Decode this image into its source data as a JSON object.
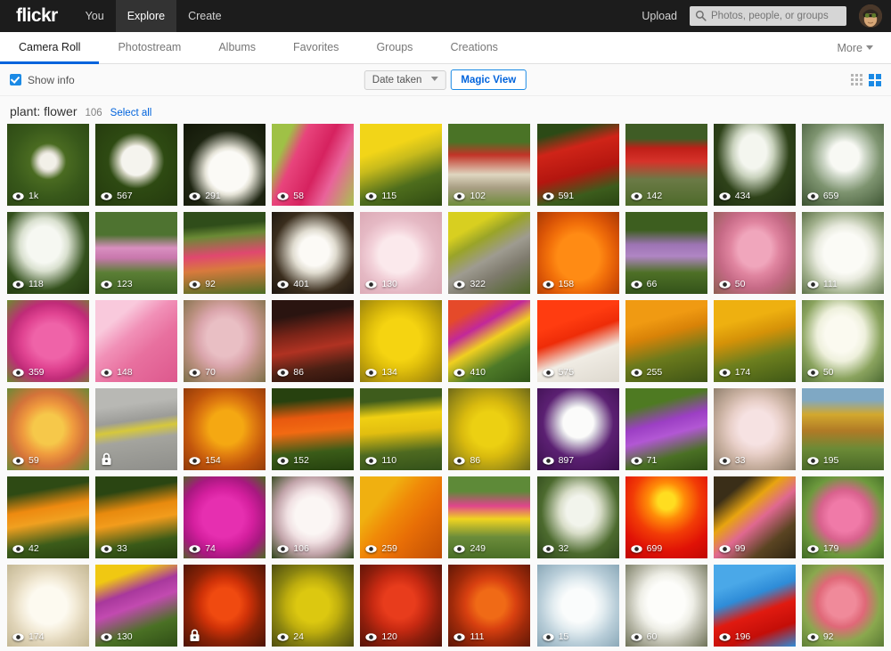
{
  "header": {
    "logo": "flickr",
    "nav": [
      {
        "label": "You",
        "active": false
      },
      {
        "label": "Explore",
        "active": true
      },
      {
        "label": "Create",
        "active": false
      }
    ],
    "upload_label": "Upload",
    "search": {
      "placeholder": "Photos, people, or groups",
      "value": "",
      "icon": "search-icon"
    },
    "avatar_alt": "user-avatar"
  },
  "tabs": [
    {
      "label": "Camera Roll",
      "active": true
    },
    {
      "label": "Photostream",
      "active": false
    },
    {
      "label": "Albums",
      "active": false
    },
    {
      "label": "Favorites",
      "active": false
    },
    {
      "label": "Groups",
      "active": false
    },
    {
      "label": "Creations",
      "active": false
    }
  ],
  "more_tab": {
    "label": "More",
    "icon": "chevron-down-icon"
  },
  "toolbar": {
    "show_info_label": "Show info",
    "show_info_checked": true,
    "sort_label": "Date taken",
    "sort_icon": "chevron-down-icon",
    "magic_view_label": "Magic View",
    "view_small_icon": "grid-small-icon",
    "view_large_icon": "grid-large-icon",
    "view_active": "large"
  },
  "group": {
    "title": "plant: flower",
    "count": "106",
    "select_all_label": "Select all"
  },
  "colors": {
    "accent": "#0063dc",
    "accent_light": "#1b8ae5",
    "topbar_bg": "#1c1c1c",
    "page_bg": "#fafafa"
  },
  "photos": [
    {
      "views": "1k",
      "locked": false,
      "name": "dandelion-seedhead-green",
      "bg": "radial-gradient(circle at 50% 46%, #f2f0e8 0 13%, #d8d6c8 17%, #4a6b21 30%, #38581a 60%, #2c4714 100%)"
    },
    {
      "views": "567",
      "locked": false,
      "name": "dandelion-seedhead-dark",
      "bg": "radial-gradient(circle at 50% 45%, #f5f4ee 0 24%, #cfd0bd 28%, #2e4a12 46%, #24390e 100%)"
    },
    {
      "views": "291",
      "locked": false,
      "name": "white-camellia",
      "bg": "radial-gradient(circle at 55% 58%, #fbfaf6 0 30%, #e4e2d6 36%, #1d2411 62%, #121708 100%)"
    },
    {
      "views": "58",
      "locked": false,
      "name": "pink-ginger-flower",
      "bg": "linear-gradient(115deg, #9fc146 0 18%, #e8447c 32%, #d6225f 55%, #e9639a 72%, #a8c24f 100%)"
    },
    {
      "views": "115",
      "locked": false,
      "name": "yellow-tulips-field",
      "bg": "linear-gradient(160deg, #f2d518 0 30%, #c8bb1c 45%, #4e6d1c 70%, #2f4a12 100%)"
    },
    {
      "views": "102",
      "locked": false,
      "name": "red-tulip-garden-path",
      "bg": "linear-gradient(180deg, #4a7326 0 22%, #c23427 38%, #dfd6c0 62%, #a89e83 78%, #6e8c3a 100%)"
    },
    {
      "views": "591",
      "locked": false,
      "name": "red-tulips-closeup",
      "bg": "linear-gradient(165deg, #2c4a16 0 14%, #cf2418 32%, #b4160f 58%, #3c5c1c 80%, #2a4512 100%)"
    },
    {
      "views": "142",
      "locked": false,
      "name": "red-tulip-rows",
      "bg": "linear-gradient(180deg, #3f5c25 0 18%, #c01f18 30%, #d6332a 46%, #6b7a46 68%, #4e6a2a 100%)"
    },
    {
      "views": "434",
      "locked": false,
      "name": "white-queen-annes-lace",
      "bg": "radial-gradient(ellipse at 48% 34%, #f4f6ef 0 22%, #c9d2bd 34%, #2e4219 60%, #1d2c10 100%)"
    },
    {
      "views": "659",
      "locked": false,
      "name": "dandelion-backlit",
      "bg": "radial-gradient(circle at 52% 40%, #f8f9f4 0 22%, #cfd8c9 32%, #7e9470 55%, #3b5230 100%)"
    },
    {
      "views": "118",
      "locked": false,
      "name": "white-hydrangea-bush",
      "bg": "radial-gradient(ellipse at 45% 40%, #f6f8f2 0 26%, #d9e0cf 38%, #33501c 66%, #22380f 100%)"
    },
    {
      "views": "123",
      "locked": false,
      "name": "pink-tulip-meadow",
      "bg": "linear-gradient(180deg, #4e7330 0 28%, #d98fc0 44%, #c878ad 56%, #5b7f35 74%, #3e6122 100%)"
    },
    {
      "views": "92",
      "locked": false,
      "name": "person-in-flower-field",
      "bg": "linear-gradient(175deg, #2f4d1a 0 18%, #6a8a35 30%, #e0486f 52%, #d97a3d 68%, #4c6d24 100%)"
    },
    {
      "views": "401",
      "locked": false,
      "name": "white-cherry-blossom",
      "bg": "radial-gradient(ellipse at 52% 48%, #fcfaf6 0 24%, #e0dcd0 36%, #3a2d1d 68%, #1d1610 100%)"
    },
    {
      "views": "130",
      "locked": false,
      "name": "pink-cherry-blossom",
      "bg": "radial-gradient(ellipse at 46% 52%, #fbe9ec 0 30%, #f2d0d8 44%, #e5b9c4 62%, #d9a6b2 100%)"
    },
    {
      "views": "322",
      "locked": false,
      "name": "stone-steps-yellow-flowers",
      "bg": "linear-gradient(150deg, #d8cf20 0 22%, #9aa428 36%, #9e9b90 54%, #7f7b6e 70%, #4c6524 100%)"
    },
    {
      "views": "158",
      "locked": false,
      "name": "orange-tulip-macro",
      "bg": "radial-gradient(ellipse at 50% 55%, #ff8b14 0 36%, #f2700a 52%, #d85306 72%, #a83a04 100%)"
    },
    {
      "views": "66",
      "locked": false,
      "name": "purple-tulip-field",
      "bg": "linear-gradient(180deg, #3d5e1f 0 22%, #9d74b4 40%, #b085c4 54%, #4e7026 74%, #33521a 100%)"
    },
    {
      "views": "50",
      "locked": false,
      "name": "pink-blossom-tree",
      "bg": "radial-gradient(ellipse at 50% 45%, #f0a6bc 0 28%, #e085a0 42%, #c66a86 62%, #8e5f52 100%)"
    },
    {
      "views": "111",
      "locked": false,
      "name": "white-lotus-flower",
      "bg": "radial-gradient(ellipse at 52% 50%, #fbfbf6 0 34%, #e8eade 48%, #9fae8a 72%, #5d7248 100%)"
    },
    {
      "views": "359",
      "locked": false,
      "name": "pink-azalea-macro",
      "bg": "radial-gradient(ellipse at 55% 50%, #ef63a8 0 30%, #e04391 48%, #c02b78 66%, #6b8b2e 100%)"
    },
    {
      "views": "148",
      "locked": false,
      "name": "pink-tulip-petal",
      "bg": "linear-gradient(140deg, #f9c9dc 0 24%, #f190b7 42%, #e8709f 62%, #dd588d 100%)"
    },
    {
      "views": "70",
      "locked": false,
      "name": "pink-blossom-branch",
      "bg": "radial-gradient(ellipse at 50% 46%, #e9bfc4 0 30%, #dba6ad 46%, #b98f7e 66%, #7c6f48 100%)"
    },
    {
      "views": "86",
      "locked": false,
      "name": "red-flower-stems-dark",
      "bg": "linear-gradient(170deg, #2a1410 0 20%, #7a2418 40%, #b03222 58%, #4a2014 80%, #2a120c 100%)"
    },
    {
      "views": "134",
      "locked": false,
      "name": "yellow-forsythia",
      "bg": "radial-gradient(ellipse at 48% 48%, #f5d411 0 34%, #e2c10c 50%, #c2a30a 70%, #8c7a12 100%)"
    },
    {
      "views": "410",
      "locked": false,
      "name": "mixed-tulip-bouquet",
      "bg": "linear-gradient(150deg, #e54a2a 0 18%, #c2289a 34%, #f0d020 50%, #4e7a28 72%, #2f5418 100%)"
    },
    {
      "views": "575",
      "locked": false,
      "name": "red-poppies-white",
      "bg": "linear-gradient(160deg, #ff3c10 0 28%, #ee2c08 44%, #f0ece4 66%, #ddd8ce 100%)"
    },
    {
      "views": "255",
      "locked": false,
      "name": "orange-tulips-sunlit",
      "bg": "linear-gradient(165deg, #f09a12 0 26%, #d98308 42%, #6b7a1c 66%, #3e5416 100%)"
    },
    {
      "views": "174",
      "locked": false,
      "name": "yellow-tulips-sunlit",
      "bg": "linear-gradient(165deg, #eeb010 0 26%, #d59208 44%, #6d7f1e 68%, #3f5816 100%)"
    },
    {
      "views": "50",
      "locked": false,
      "name": "white-frangipani",
      "bg": "radial-gradient(ellipse at 48% 42%, #fbfaf0 0 26%, #eef0dc 40%, #8aa35e 66%, #4d6b33 100%)"
    },
    {
      "views": "59",
      "locked": false,
      "name": "orange-yellow-blossoms",
      "bg": "radial-gradient(ellipse at 50% 50%, #f6c84a 0 26%, #ef9a3e 44%, #d4733a 64%, #6b8a36 100%)"
    },
    {
      "views": "",
      "locked": true,
      "name": "road-with-yellow-lines",
      "bg": "linear-gradient(172deg, #b8b8b4 0 22%, #9c9c98 40%, #d6c83c 50%, #a4a49e 62%, #8e8e8a 100%)"
    },
    {
      "views": "154",
      "locked": false,
      "name": "autumn-maple-leaf",
      "bg": "radial-gradient(ellipse at 52% 48%, #f5a812 0 28%, #e07d10 46%, #c2560c 66%, #8e3808 100%)"
    },
    {
      "views": "152",
      "locked": false,
      "name": "orange-tulips-green",
      "bg": "linear-gradient(175deg, #27410f 0 16%, #e8590f 36%, #f26a12 52%, #3b5c18 76%, #24400e 100%)"
    },
    {
      "views": "110",
      "locked": false,
      "name": "yellow-tulips-rows",
      "bg": "linear-gradient(175deg, #3e5c1c 0 16%, #f0d012 34%, #e2be10 52%, #4e6a20 76%, #33511a 100%)"
    },
    {
      "views": "86",
      "locked": false,
      "name": "yellow-forsythia-branch",
      "bg": "radial-gradient(ellipse at 50% 50%, #ecd012 0 30%, #d9ba0e 48%, #b09c14 68%, #6f6a18 100%)"
    },
    {
      "views": "897",
      "locked": false,
      "name": "dandelion-purple-bg",
      "bg": "radial-gradient(circle at 50% 42%, #fbfbfa 0 24%, #d8d4df 30%, #5b2072 56%, #3a0e4c 100%)"
    },
    {
      "views": "71",
      "locked": false,
      "name": "purple-wildflowers",
      "bg": "linear-gradient(165deg, #4e7a22 0 22%, #9c3fc4 42%, #b257d4 56%, #4a7024 78%, #2f4e16 100%)"
    },
    {
      "views": "33",
      "locked": false,
      "name": "pink-blossom-hand",
      "bg": "radial-gradient(ellipse at 52% 48%, #f6e2e2 0 28%, #e8cfc8 44%, #c8b0a0 64%, #8a7a68 100%)"
    },
    {
      "views": "195",
      "locked": false,
      "name": "autumn-forest-hills",
      "bg": "linear-gradient(180deg, #7fa8c4 0 14%, #d2a82e 32%, #b07a26 52%, #6b8a36 74%, #4a6a28 100%)"
    },
    {
      "views": "42",
      "locked": false,
      "name": "orange-tulip-bud",
      "bg": "linear-gradient(170deg, #2e4a14 0 20%, #ee8a10 40%, #f0a020 54%, #3c5c1a 78%, #27400f 100%)"
    },
    {
      "views": "33",
      "locked": false,
      "name": "orange-tulip-bud-two",
      "bg": "linear-gradient(170deg, #2a4512 0 20%, #e88a0e 40%, #f29c1c 54%, #3a5a18 78%, #243c0e 100%)"
    },
    {
      "views": "74",
      "locked": false,
      "name": "magenta-bougainvillea",
      "bg": "radial-gradient(ellipse at 48% 50%, #e62fb0 0 34%, #d41f9e 50%, #a81880 70%, #4c6a22 100%)"
    },
    {
      "views": "106",
      "locked": false,
      "name": "white-hibiscus",
      "bg": "radial-gradient(ellipse at 50% 48%, #fbf6f4 0 30%, #f0e0e2 44%, #c2a4aa 64%, #2e4418 100%)"
    },
    {
      "views": "259",
      "locked": false,
      "name": "orange-tulip-macro-two",
      "bg": "linear-gradient(130deg, #f0b010 0 26%, #f08a08 44%, #e86e06 64%, #c04e04 100%)"
    },
    {
      "views": "249",
      "locked": false,
      "name": "tulip-garden-pink-yellow",
      "bg": "linear-gradient(180deg, #5e8a38 0 18%, #e0458c 36%, #f0d420 52%, #6b8c3a 74%, #4a6e26 100%)"
    },
    {
      "views": "32",
      "locked": false,
      "name": "white-flower-stem",
      "bg": "radial-gradient(ellipse at 52% 42%, #f2f4ec 0 22%, #d8ddc8 34%, #4c6a2e 64%, #2c441a 100%)"
    },
    {
      "views": "699",
      "locked": false,
      "name": "red-orange-sunburst",
      "bg": "radial-gradient(circle at 50% 30%, #ffdd20 0 12%, #ff8c08 26%, #f23c06 48%, #e01206 72%, #c00804 100%)"
    },
    {
      "views": "99",
      "locked": false,
      "name": "yellow-flowers-fence",
      "bg": "linear-gradient(140deg, #3a2e18 0 20%, #e8a410 38%, #e06890 54%, #5a4422 76%, #2e2412 100%)"
    },
    {
      "views": "179",
      "locked": false,
      "name": "pink-flowers-green",
      "bg": "radial-gradient(ellipse at 52% 48%, #f07aa8 0 26%, #d9628e 42%, #6e9a3e 66%, #3f6a24 100%)"
    },
    {
      "views": "174",
      "locked": false,
      "name": "white-rose",
      "bg": "radial-gradient(ellipse at 50% 50%, #fdfaf0 0 32%, #f2ead6 48%, #e0d4b8 66%, #c4b894 100%)"
    },
    {
      "views": "130",
      "locked": false,
      "name": "purple-yellow-tulips",
      "bg": "linear-gradient(160deg, #f0c812 0 18%, #a8389c 36%, #c24ab0 50%, #4a7024 74%, #2f4e16 100%)"
    },
    {
      "views": "",
      "locked": true,
      "name": "autumn-red-bokeh",
      "bg": "radial-gradient(ellipse at 50% 48%, #f04a10 0 26%, #d03208 42%, #8a2206 64%, #4a1404 100%)"
    },
    {
      "views": "24",
      "locked": false,
      "name": "yellow-forsythia-dense",
      "bg": "radial-gradient(ellipse at 50% 50%, #dcc810 0 28%, #bfae0e 46%, #8a8410 66%, #4e4e10 100%)"
    },
    {
      "views": "120",
      "locked": false,
      "name": "red-bokeh-leaves",
      "bg": "radial-gradient(ellipse at 48% 46%, #e83c1c 0 26%, #c82a12 44%, #8e1e0c 66%, #4e1206 100%)"
    },
    {
      "views": "111",
      "locked": false,
      "name": "autumn-red-orange-bokeh",
      "bg": "radial-gradient(ellipse at 52% 48%, #f06a16 0 24%, #d84010 42%, #a02a0a 64%, #5a1606 100%)"
    },
    {
      "views": "15",
      "locked": false,
      "name": "magnolia-bud-sky",
      "bg": "radial-gradient(ellipse at 50% 50%, #fafcfc 0 28%, #e2ecf0 44%, #b8cdd8 66%, #8aa8b8 100%)"
    },
    {
      "views": "60",
      "locked": false,
      "name": "white-magnolia-flower",
      "bg": "radial-gradient(ellipse at 50% 46%, #fdfdfa 0 32%, #eeeee6 46%, #b8b8a8 68%, #6e7258 100%)"
    },
    {
      "views": "196",
      "locked": false,
      "name": "red-flower-blue-sky",
      "bg": "linear-gradient(160deg, #4aa8e8 0 24%, #2e8cd8 40%, #e01a10 58%, #c40e08 78%, #2e8cd8 100%)"
    },
    {
      "views": "92",
      "locked": false,
      "name": "pink-geranium-cluster",
      "bg": "radial-gradient(ellipse at 48% 46%, #f08a9a 0 24%, #e06878 40%, #8aa84e 64%, #5a7a34 100%)"
    }
  ]
}
